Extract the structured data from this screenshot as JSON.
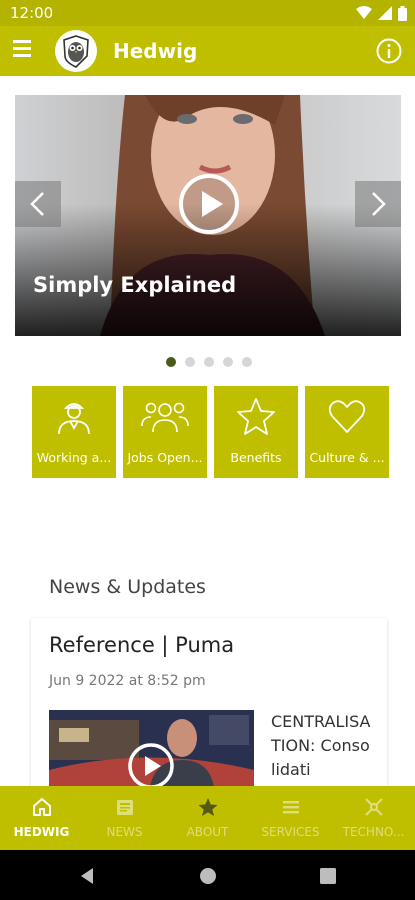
{
  "status_bar": {
    "time": "12:00",
    "icons": [
      "wifi-icon",
      "signal-icon",
      "battery-icon"
    ]
  },
  "app_bar": {
    "title": "Hedwig",
    "logo": "owl-logo",
    "menu_icon": "menu-icon",
    "info_icon": "info-icon"
  },
  "hero": {
    "caption": "Simply Explained",
    "slide_count": 5,
    "active_slide": 1
  },
  "tiles": [
    {
      "label": "Working a...",
      "icon": "worker-icon"
    },
    {
      "label": "Jobs Open...",
      "icon": "team-icon"
    },
    {
      "label": "Benefits",
      "icon": "star-icon"
    },
    {
      "label": "Culture & ...",
      "icon": "heart-icon"
    }
  ],
  "news": {
    "section_title": "News & Updates",
    "card": {
      "title": "Reference | Puma",
      "date": "Jun 9 2022 at 8:52 pm",
      "excerpt": "CENTRALISATION: Consolidati"
    }
  },
  "bottom_nav": [
    {
      "label": "HEDWIG",
      "icon": "home-icon",
      "active": true
    },
    {
      "label": "NEWS",
      "icon": "news-icon",
      "active": false
    },
    {
      "label": "ABOUT",
      "icon": "star-icon",
      "active": false
    },
    {
      "label": "SERVICES",
      "icon": "list-icon",
      "active": false
    },
    {
      "label": "TECHNO...",
      "icon": "tools-icon",
      "active": false
    }
  ],
  "colors": {
    "accent": "#bfbf00",
    "status_bar": "#b3b300",
    "active_dot": "#4a5a1a"
  }
}
